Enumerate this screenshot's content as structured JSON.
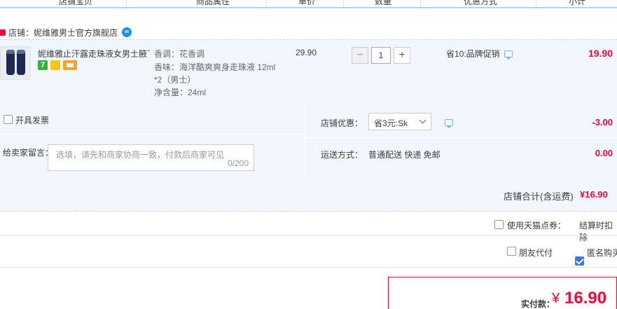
{
  "header": {
    "columns": [
      "店铺宝贝",
      "商品属性",
      "单价",
      "数量",
      "优惠方式",
      "小计"
    ]
  },
  "shop": {
    "name": "店铺：妮维雅男士官方旗舰店"
  },
  "item": {
    "title": "妮维雅止汗露走珠液女男士腋下...",
    "attrs": [
      "香调：花香调",
      "香味：海洋酷爽爽身走珠液 12ml",
      "*2（男士）",
      "净含量：24ml"
    ],
    "price": "29.90",
    "quantity": "1",
    "minus": "−",
    "plus": "+",
    "promo": "省10:品牌促销",
    "subtotal": "19.90",
    "badge7": "7"
  },
  "invoice": {
    "label": "开具发票"
  },
  "note": {
    "label": "给卖家留言：",
    "placeholder": "选填，请先和商家协商一致，付款后商家可见",
    "count": "0/200"
  },
  "discount": {
    "label": "店铺优惠：",
    "selected": "省3元:Sk",
    "value": "-3.00"
  },
  "shipping": {
    "label": "运送方式：",
    "method": "普通配送 快递 免邮",
    "value": "0.00"
  },
  "shop_total": {
    "label": "店铺合计(含运费)",
    "value": "¥16.90"
  },
  "tmall_points": {
    "label": "使用天猫点券：",
    "note": "结算时扣除"
  },
  "options": {
    "friend_pay": "朋友代付",
    "anonymous": "匿名购买"
  },
  "payment": {
    "label": "实付款：",
    "currency": "¥",
    "value": "16.90"
  }
}
